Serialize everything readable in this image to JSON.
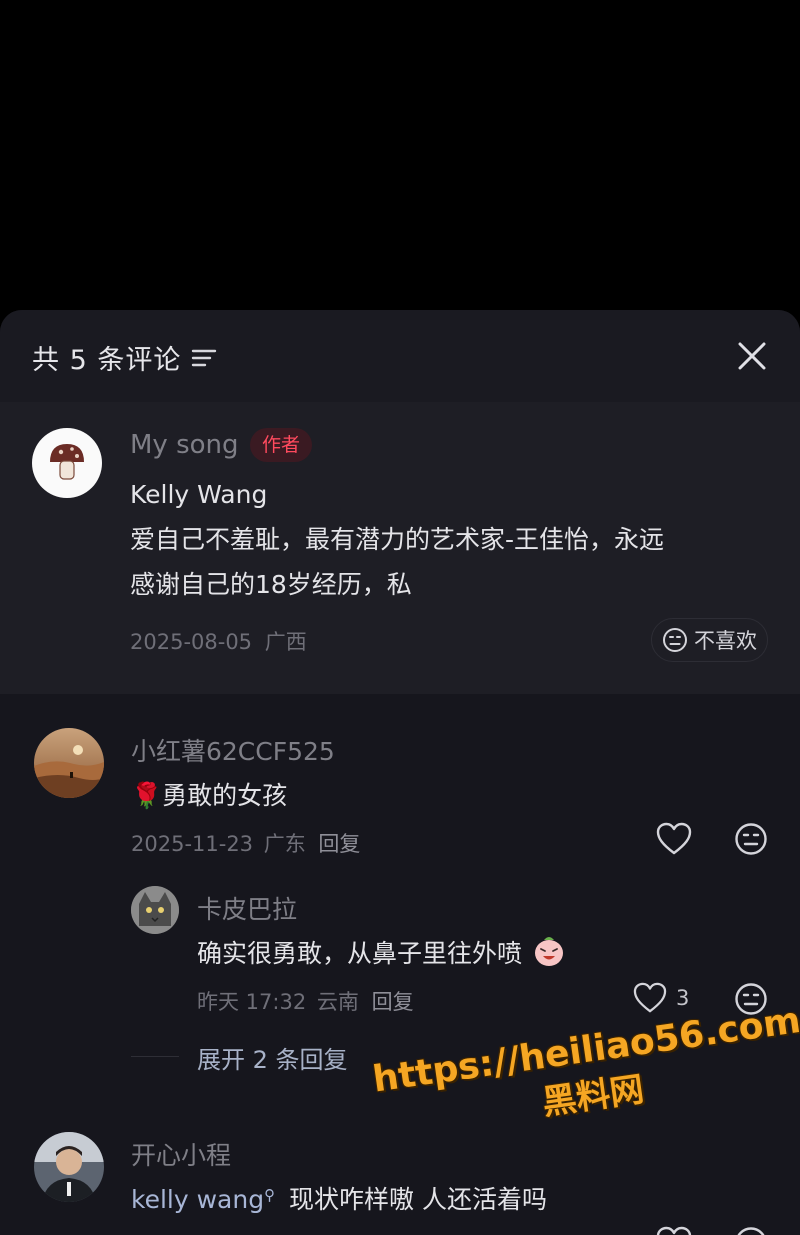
{
  "header": {
    "title": "共 5 条评论",
    "filter_icon": "filter-icon",
    "close_icon": "close-icon"
  },
  "author_comment": {
    "name": "My song",
    "badge": "作者",
    "line1": "Kelly Wang",
    "line2": "爱自己不羞耻，最有潜力的艺术家-王佳怡，永远",
    "line3": "感谢自己的18岁经历，私",
    "date": "2025-08-05",
    "location": "广西",
    "dislike_label": "不喜欢"
  },
  "comments": [
    {
      "name": "小红薯62CCF525",
      "emoji": "🌹",
      "text": "勇敢的女孩",
      "date": "2025-11-23",
      "location": "广东",
      "reply_label": "回复"
    }
  ],
  "reply": {
    "name": "卡皮巴拉",
    "text": "确实很勇敢，从鼻子里往外喷",
    "time": "昨天 17:32",
    "location": "云南",
    "reply_label": "回复",
    "like_count": "3"
  },
  "expand_label": "展开 2 条回复",
  "comment3": {
    "name": "开心小程",
    "mention": "kelly wang",
    "text": "现状咋样嗷  人还活着吗"
  },
  "watermark": {
    "line1": "https://heiliao56.com",
    "line2": "黑料网"
  }
}
